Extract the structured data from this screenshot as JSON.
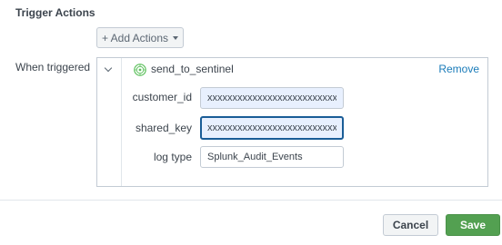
{
  "section": {
    "title": "Trigger Actions"
  },
  "add_actions": {
    "label": "+ Add Actions"
  },
  "when_triggered": {
    "label": "When triggered"
  },
  "action": {
    "name": "send_to_sentinel",
    "remove_label": "Remove",
    "icon": "sentinel-logo-icon",
    "fields": [
      {
        "label": "customer_id",
        "value": "xxxxxxxxxxxxxxxxxxxxxxxxxxxx"
      },
      {
        "label": "shared_key",
        "value": "xxxxxxxxxxxxxxxxxxxxxxxxxxxx"
      },
      {
        "label": "log type",
        "value": "Splunk_Audit_Events"
      }
    ]
  },
  "footer": {
    "cancel_label": "Cancel",
    "save_label": "Save"
  },
  "colors": {
    "link": "#1a7bb9",
    "save": "#53a051",
    "focus_border": "#1a5d97",
    "autofill": "#e8f0fe"
  }
}
